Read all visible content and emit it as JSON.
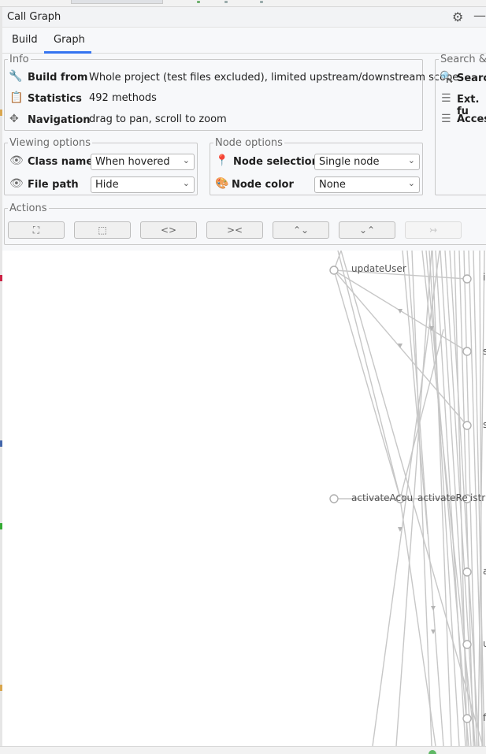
{
  "window": {
    "title": "Call Graph"
  },
  "tabs": [
    {
      "label": "Build"
    },
    {
      "label": "Graph"
    }
  ],
  "active_tab": "Graph",
  "info": {
    "legend": "Info",
    "rows": [
      {
        "icon": "wrench-icon",
        "label": "Build from",
        "value": "Whole project (test files excluded), limited upstream/downstream scope"
      },
      {
        "icon": "clipboard-icon",
        "label": "Statistics",
        "value": "492 methods"
      },
      {
        "icon": "move-icon",
        "label": "Navigation",
        "value": "drag to pan, scroll to zoom"
      }
    ]
  },
  "search": {
    "legend": "Search &",
    "rows": [
      {
        "icon": "search-icon",
        "label": "Search"
      },
      {
        "icon": "filter-icon",
        "label": "Ext. fu"
      },
      {
        "icon": "filter-icon",
        "label": "Access"
      }
    ]
  },
  "viewing_options": {
    "legend": "Viewing options",
    "class_name": {
      "icon": "eye-icon",
      "label": "Class name",
      "value": "When hovered"
    },
    "file_path": {
      "icon": "eye-icon",
      "label": "File path",
      "value": "Hide"
    }
  },
  "node_options": {
    "legend": "Node options",
    "node_selection": {
      "icon": "pin-icon",
      "label": "Node selection",
      "value": "Single node"
    },
    "node_color": {
      "icon": "palette-icon",
      "label": "Node color",
      "value": "None"
    }
  },
  "actions": {
    "legend": "Actions",
    "buttons": [
      {
        "name": "fit-to-view",
        "glyph": "⛶",
        "enabled": true
      },
      {
        "name": "fit-selection",
        "glyph": "⬚",
        "enabled": true
      },
      {
        "name": "expand-horizontal",
        "glyph": "<>",
        "enabled": true
      },
      {
        "name": "collapse-horizontal",
        "glyph": "><",
        "enabled": true
      },
      {
        "name": "expand-vertical",
        "glyph": "⌃⌄",
        "enabled": true
      },
      {
        "name": "collapse-vertical",
        "glyph": "⌄⌃",
        "enabled": true
      },
      {
        "name": "upstream-arrow",
        "glyph": "↣",
        "enabled": false
      }
    ]
  },
  "graph": {
    "node_labels": [
      {
        "text": "updateUser"
      },
      {
        "text": "activateAcou"
      },
      {
        "text": "activateRe"
      },
      {
        "text": "istra"
      },
      {
        "text": "i"
      },
      {
        "text": "s"
      },
      {
        "text": "s"
      },
      {
        "text": "a"
      },
      {
        "text": "u"
      },
      {
        "text": "f"
      }
    ]
  },
  "colors": {
    "accent": "#3574f0",
    "edge": "#c7c7c7",
    "status_ok": "#5fb865"
  }
}
